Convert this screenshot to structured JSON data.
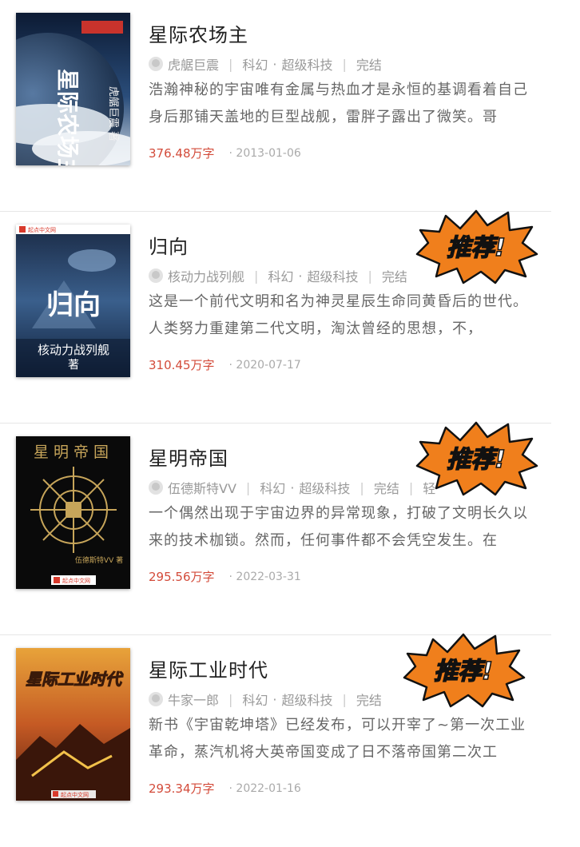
{
  "books": [
    {
      "title": "星际农场主",
      "author": "虎艍巨震",
      "category": "科幻",
      "subcategory": "超级科技",
      "status": "完结",
      "desc": "浩瀚神秘的宇宙唯有金属与热血才是永恒的基调看着自己身后那铺天盖地的巨型战舰，雷胖子露出了微笑。哥",
      "words": "376.48万字",
      "date": "2013-01-06",
      "cover_title": "星际农场主",
      "cover_author": "虎艍巨震 著",
      "recommended": false
    },
    {
      "title": "归向",
      "author": "核动力战列舰",
      "category": "科幻",
      "subcategory": "超级科技",
      "status": "完结",
      "desc": "这是一个前代文明和名为神灵星辰生命同黄昏后的世代。人类努力重建第二代文明，淘汰曾经的思想，不，",
      "words": "310.45万字",
      "date": "2020-07-17",
      "cover_title": "归向",
      "cover_author": "核动力战列舰",
      "cover_author2": "著",
      "cover_publisher": "起点中文网",
      "recommended": true
    },
    {
      "title": "星明帝国",
      "author": "伍德斯特VV",
      "category": "科幻",
      "subcategory": "超级科技",
      "status": "完结",
      "extra": "轻",
      "desc": "一个偶然出现于宇宙边界的异常现象，打破了文明长久以来的技术枷锁。然而，任何事件都不会凭空发生。在",
      "words": "295.56万字",
      "date": "2022-03-31",
      "cover_title": "星明帝国",
      "cover_author": "伍德斯特VV 著",
      "cover_publisher": "起点中文网",
      "recommended": true
    },
    {
      "title": "星际工业时代",
      "author": "牛家一郎",
      "category": "科幻",
      "subcategory": "超级科技",
      "status": "完结",
      "desc": "新书《宇宙乾坤塔》已经发布，可以开宰了~第一次工业革命，蒸汽机将大英帝国变成了日不落帝国第二次工",
      "words": "293.34万字",
      "date": "2022-01-16",
      "cover_title": "星际工业时代",
      "cover_publisher": "起点中文网",
      "recommended": true
    }
  ],
  "badge_text": "推荐!",
  "colors": {
    "accent": "#d34b3a",
    "badge": "#f07f1c"
  }
}
